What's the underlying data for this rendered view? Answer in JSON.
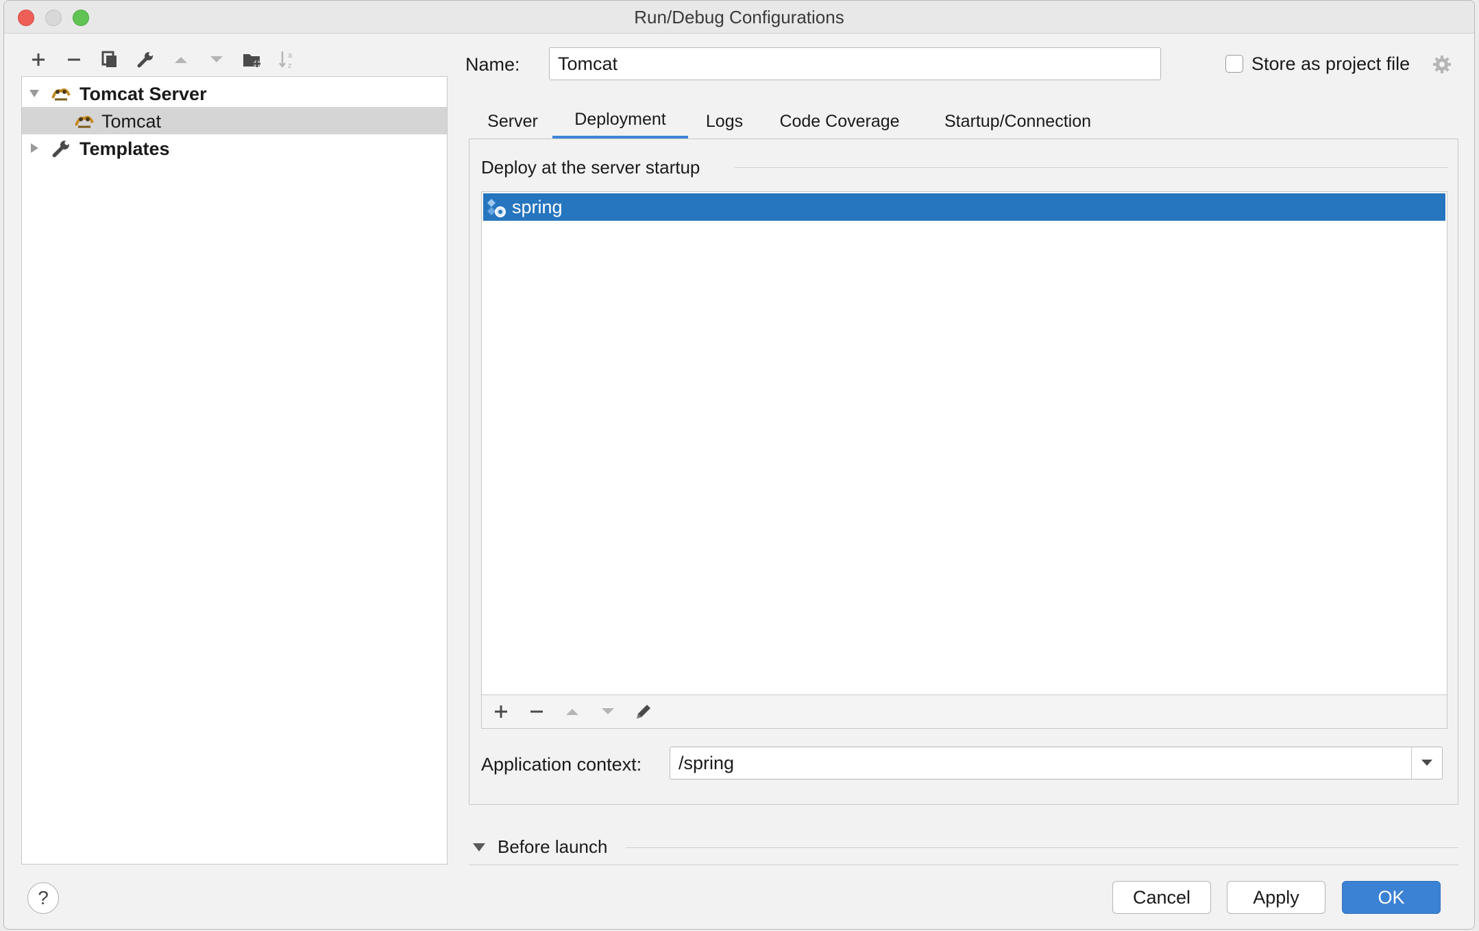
{
  "window": {
    "title": "Run/Debug Configurations"
  },
  "tree": {
    "items": [
      {
        "label": "Tomcat Server",
        "expanded": true
      },
      {
        "label": "Tomcat"
      },
      {
        "label": "Templates",
        "expanded": false
      }
    ]
  },
  "form": {
    "name_label": "Name:",
    "name_value": "Tomcat",
    "store_label": "Store as project file",
    "store_checked": false
  },
  "tabs": [
    {
      "label": "Server"
    },
    {
      "label": "Deployment",
      "active": true
    },
    {
      "label": "Logs"
    },
    {
      "label": "Code Coverage"
    },
    {
      "label": "Startup/Connection"
    }
  ],
  "deployment": {
    "section_title": "Deploy at the server startup",
    "artifacts": [
      {
        "label": "spring",
        "selected": true
      }
    ],
    "context_label": "Application context:",
    "context_value": "/spring"
  },
  "before_launch": {
    "label": "Before launch"
  },
  "buttons": {
    "cancel": "Cancel",
    "apply": "Apply",
    "ok": "OK",
    "help": "?"
  },
  "colors": {
    "selection": "#2675bf",
    "primary_button": "#3b82d4",
    "active_tab": "#3d85d6"
  }
}
